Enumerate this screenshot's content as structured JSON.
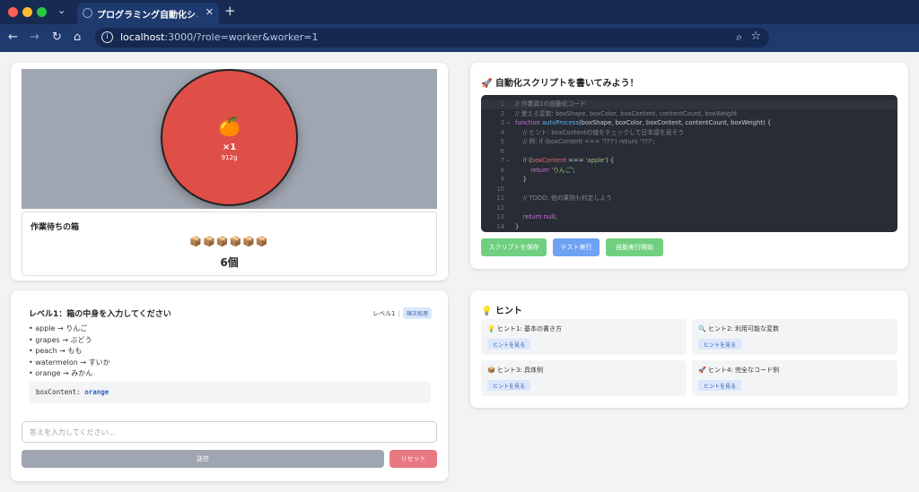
{
  "browser": {
    "tab_title": "プログラミング自動化シミュレ...",
    "url_host": "localhost",
    "url_rest": ":3000/?role=worker&worker=1",
    "new_tab_glyph": "+",
    "close_glyph": "✕"
  },
  "box": {
    "fruit_emoji": "🍊",
    "count_label": "×1",
    "weight_label": "912g",
    "color": "#e04f47"
  },
  "queue": {
    "title": "作業待ちの箱",
    "boxes": "📦📦📦📦📦📦",
    "count": "6個"
  },
  "level": {
    "title": "レベル1：箱の中身を入力してください",
    "level_label": "レベル1",
    "mode_badge": "順次処理",
    "mapping": [
      "• apple → りんご",
      "• grapes → ぶどう",
      "• peach → もも",
      "• watermelon → すいか",
      "• orange → みかん"
    ],
    "content_label": "boxContent:",
    "content_value": "orange",
    "answer_placeholder": "答えを入力してください...",
    "submit_label": "送信",
    "reset_label": "リセット"
  },
  "editor": {
    "title": "🚀 自動化スクリプトを書いてみよう！",
    "save_label": "スクリプトを保存",
    "test_label": "テスト実行",
    "auto_label": "自動実行開始"
  },
  "hints": {
    "title": "💡 ヒント",
    "items": [
      {
        "label": "💡 ヒント1: 基本の書き方",
        "button": "ヒントを見る"
      },
      {
        "label": "🔍 ヒント2: 利用可能な変数",
        "button": "ヒントを見る"
      },
      {
        "label": "📦 ヒント3: 具体例",
        "button": "ヒントを見る"
      },
      {
        "label": "🚀 ヒント4: 完全なコード例",
        "button": "ヒントを見る"
      }
    ]
  }
}
